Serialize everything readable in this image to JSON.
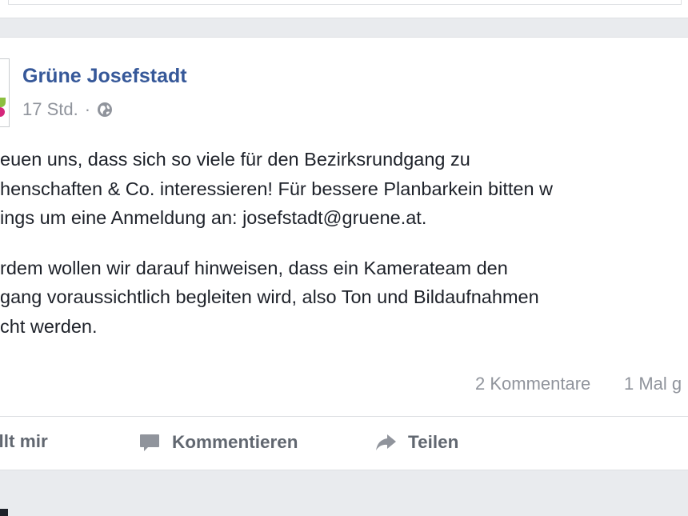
{
  "post": {
    "author": "Grüne Josefstadt",
    "timestamp": "17 Std.",
    "separator": "·",
    "privacy_icon": "globe-icon",
    "text_lines_p1": [
      "euen uns, dass sich so viele für den Bezirksrundgang zu",
      "henschaften & Co. interessieren! Für bessere Planbarkein bitten w",
      "ings um eine Anmeldung an: josefstadt@gruene.at."
    ],
    "text_lines_p2": [
      "rdem wollen wir darauf hinweisen, dass ein Kamerateam den",
      "gang voraussichtlich begleiten wird, also Ton und Bildaufnahmen",
      "cht werden."
    ],
    "comments_count": "2 Kommentare",
    "shares_count": "1 Mal g"
  },
  "actions": {
    "like_label": "efällt mir",
    "comment_label": "Kommentieren",
    "share_label": "Teilen"
  },
  "colors": {
    "page_bg": "#e9ebee",
    "card_bg": "#ffffff",
    "link_blue": "#365899",
    "meta_gray": "#90949c",
    "text": "#1d2129",
    "action_gray": "#616770"
  }
}
